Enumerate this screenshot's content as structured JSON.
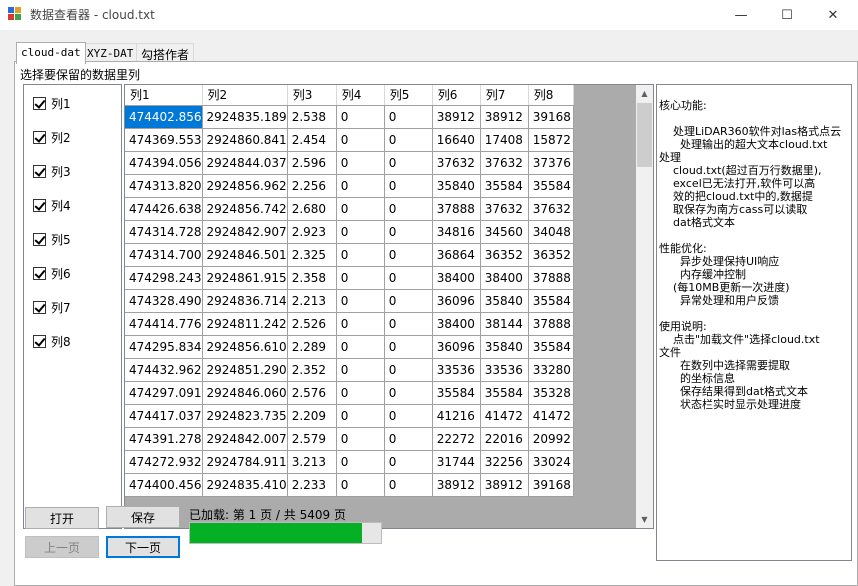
{
  "window": {
    "title": "数据查看器 - cloud.txt",
    "controls": {
      "minimize": "—",
      "maximize": "☐",
      "close": "✕"
    }
  },
  "tabs": [
    {
      "label": "cloud-dat",
      "active": true
    },
    {
      "label": "XYZ-DAT",
      "active": false
    },
    {
      "label": "勾搭作者",
      "active": false
    }
  ],
  "column_select": {
    "label": "选择要保留的数据里列",
    "items": [
      {
        "label": "列1",
        "checked": true
      },
      {
        "label": "列2",
        "checked": true
      },
      {
        "label": "列3",
        "checked": true
      },
      {
        "label": "列4",
        "checked": true
      },
      {
        "label": "列5",
        "checked": true
      },
      {
        "label": "列6",
        "checked": true
      },
      {
        "label": "列7",
        "checked": true
      },
      {
        "label": "列8",
        "checked": true
      }
    ]
  },
  "grid": {
    "headers": [
      "列1",
      "列2",
      "列3",
      "列4",
      "列5",
      "列6",
      "列7",
      "列8"
    ],
    "rows": [
      [
        "474402.856",
        "2924835.189",
        "2.538",
        "0",
        "0",
        "38912",
        "38912",
        "39168"
      ],
      [
        "474369.553",
        "2924860.841",
        "2.454",
        "0",
        "0",
        "16640",
        "17408",
        "15872"
      ],
      [
        "474394.056",
        "2924844.037",
        "2.596",
        "0",
        "0",
        "37632",
        "37632",
        "37376"
      ],
      [
        "474313.820",
        "2924856.962",
        "2.256",
        "0",
        "0",
        "35840",
        "35584",
        "35584"
      ],
      [
        "474426.638",
        "2924856.742",
        "2.680",
        "0",
        "0",
        "37888",
        "37632",
        "37632"
      ],
      [
        "474314.728",
        "2924842.907",
        "2.923",
        "0",
        "0",
        "34816",
        "34560",
        "34048"
      ],
      [
        "474314.700",
        "2924846.501",
        "2.325",
        "0",
        "0",
        "36864",
        "36352",
        "36352"
      ],
      [
        "474298.243",
        "2924861.915",
        "2.358",
        "0",
        "0",
        "38400",
        "38400",
        "37888"
      ],
      [
        "474328.490",
        "2924836.714",
        "2.213",
        "0",
        "0",
        "36096",
        "35840",
        "35584"
      ],
      [
        "474414.776",
        "2924811.242",
        "2.526",
        "0",
        "0",
        "38400",
        "38144",
        "37888"
      ],
      [
        "474295.834",
        "2924856.610",
        "2.289",
        "0",
        "0",
        "36096",
        "35840",
        "35584"
      ],
      [
        "474432.962",
        "2924851.290",
        "2.352",
        "0",
        "0",
        "33536",
        "33536",
        "33280"
      ],
      [
        "474297.091",
        "2924846.060",
        "2.576",
        "0",
        "0",
        "35584",
        "35584",
        "35328"
      ],
      [
        "474417.037",
        "2924823.735",
        "2.209",
        "0",
        "0",
        "41216",
        "41472",
        "41472"
      ],
      [
        "474391.278",
        "2924842.007",
        "2.579",
        "0",
        "0",
        "22272",
        "22016",
        "20992"
      ],
      [
        "474272.932",
        "2924784.911",
        "3.213",
        "0",
        "0",
        "31744",
        "32256",
        "33024"
      ],
      [
        "474400.456",
        "2924835.410",
        "2.233",
        "0",
        "0",
        "38912",
        "38912",
        "39168"
      ]
    ]
  },
  "info_text": "核心功能:\n\n    处理LiDAR360软件对las格式点云\n      处理输出的超大文本cloud.txt\n处理\n    cloud.txt(超过百万行数据里),\n    excel已无法打开,软件可以高\n    效的把cloud.txt中的,数据提\n    取保存为南方cass可以读取\n    dat格式文本\n\n性能优化:\n      异步处理保持UI响应\n      内存缓冲控制\n    (每10MB更新一次进度)\n      异常处理和用户反馈\n\n使用说明:\n    点击\"加载文件\"选择cloud.txt\n文件\n      在数列中选择需要提取\n      的坐标信息\n      保存结果得到dat格式文本\n      状态栏实时显示处理进度",
  "buttons": {
    "open": "打开",
    "save": "保存",
    "prev": "上一页",
    "next": "下一页"
  },
  "status": {
    "text": "已加载: 第 1 页 / 共 5409 页",
    "progress": 0.9
  },
  "colors": {
    "selection": "#0078d7",
    "progress_fill": "#06b025"
  }
}
